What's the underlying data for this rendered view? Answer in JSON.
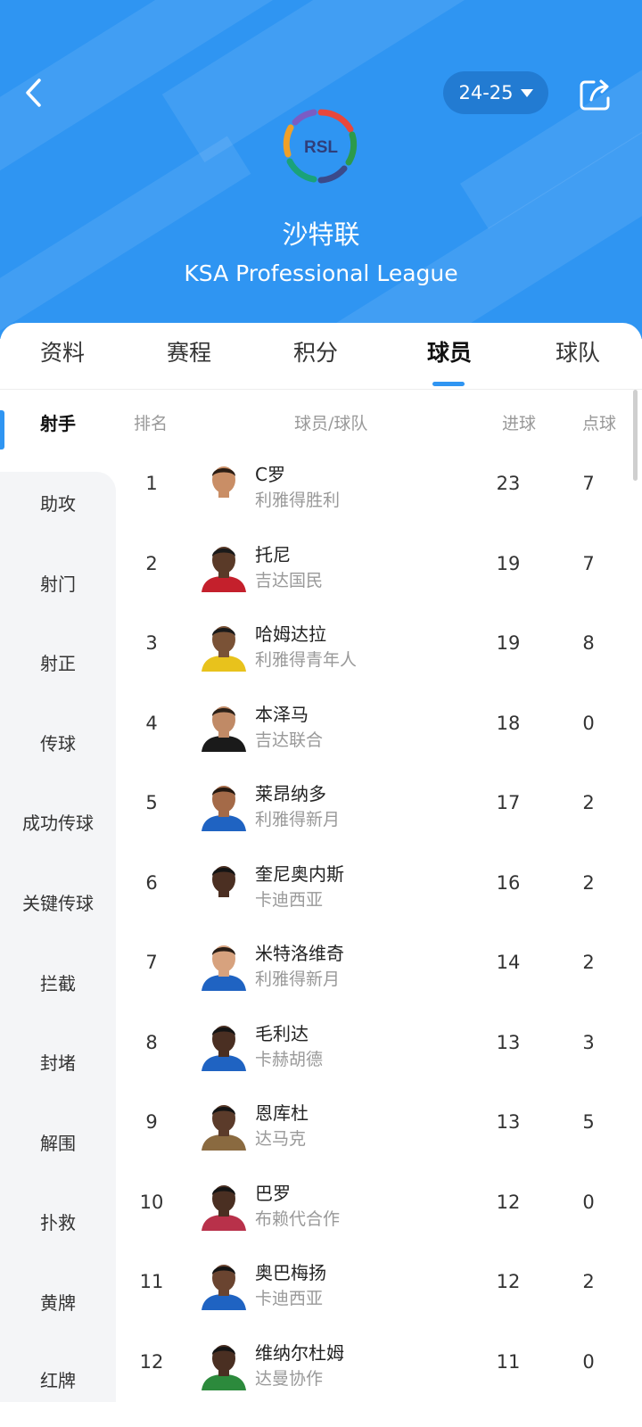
{
  "header": {
    "season": "24-25",
    "league_name": "沙特联",
    "league_name_en": "KSA Professional League",
    "logo_text": "RSL",
    "icons": {
      "back": "back-chevron-icon",
      "share": "share-icon",
      "season_dropdown": "caret-down-icon"
    },
    "colors": {
      "header_bg": "#2f95f2",
      "accent": "#2f95f2"
    }
  },
  "tabs": [
    {
      "label": "资料",
      "active": false
    },
    {
      "label": "赛程",
      "active": false
    },
    {
      "label": "积分",
      "active": false
    },
    {
      "label": "球员",
      "active": true
    },
    {
      "label": "球队",
      "active": false
    }
  ],
  "sidebar": {
    "items": [
      {
        "label": "射手",
        "active": true
      },
      {
        "label": "助攻"
      },
      {
        "label": "射门"
      },
      {
        "label": "射正"
      },
      {
        "label": "传球"
      },
      {
        "label": "成功传球"
      },
      {
        "label": "关键传球"
      },
      {
        "label": "拦截"
      },
      {
        "label": "封堵"
      },
      {
        "label": "解围"
      },
      {
        "label": "扑救"
      },
      {
        "label": "黄牌"
      },
      {
        "label": "红牌"
      }
    ]
  },
  "table": {
    "headers": {
      "rank": "排名",
      "player": "球员/球队",
      "goals": "进球",
      "penalties": "点球"
    },
    "rows": [
      {
        "rank": "1",
        "name": "C罗",
        "team": "利雅得胜利",
        "goals": "23",
        "penalties": "7"
      },
      {
        "rank": "2",
        "name": "托尼",
        "team": "吉达国民",
        "goals": "19",
        "penalties": "7"
      },
      {
        "rank": "3",
        "name": "哈姆达拉",
        "team": "利雅得青年人",
        "goals": "19",
        "penalties": "8"
      },
      {
        "rank": "4",
        "name": "本泽马",
        "team": "吉达联合",
        "goals": "18",
        "penalties": "0"
      },
      {
        "rank": "5",
        "name": "莱昂纳多",
        "team": "利雅得新月",
        "goals": "17",
        "penalties": "2"
      },
      {
        "rank": "6",
        "name": "奎尼奥内斯",
        "team": "卡迪西亚",
        "goals": "16",
        "penalties": "2"
      },
      {
        "rank": "7",
        "name": "米特洛维奇",
        "team": "利雅得新月",
        "goals": "14",
        "penalties": "2"
      },
      {
        "rank": "8",
        "name": "毛利达",
        "team": "卡赫胡德",
        "goals": "13",
        "penalties": "3"
      },
      {
        "rank": "9",
        "name": "恩库杜",
        "team": "达马克",
        "goals": "13",
        "penalties": "5"
      },
      {
        "rank": "10",
        "name": "巴罗",
        "team": "布赖代合作",
        "goals": "12",
        "penalties": "0"
      },
      {
        "rank": "11",
        "name": "奥巴梅扬",
        "team": "卡迪西亚",
        "goals": "12",
        "penalties": "2"
      },
      {
        "rank": "12",
        "name": "维纳尔杜姆",
        "team": "达曼协作",
        "goals": "11",
        "penalties": "0"
      }
    ]
  },
  "avatar_colors": [
    {
      "skin": "#c98e66",
      "hair": "#2b1d14",
      "shirt": "#ffffff"
    },
    {
      "skin": "#5a3a28",
      "hair": "#1a1a1a",
      "shirt": "#c4202c"
    },
    {
      "skin": "#7a5236",
      "hair": "#1a1a1a",
      "shirt": "#e8c21c"
    },
    {
      "skin": "#c08a66",
      "hair": "#2b2018",
      "shirt": "#1a1a1a"
    },
    {
      "skin": "#a46a48",
      "hair": "#241810",
      "shirt": "#1f63c2"
    },
    {
      "skin": "#4b2f22",
      "hair": "#141414",
      "shirt": "#ffffff"
    },
    {
      "skin": "#d7a27e",
      "hair": "#2a1e16",
      "shirt": "#1f63c2"
    },
    {
      "skin": "#4a2f22",
      "hair": "#141414",
      "shirt": "#1f63c2"
    },
    {
      "skin": "#5b3b2a",
      "hair": "#141414",
      "shirt": "#8a6a40"
    },
    {
      "skin": "#4a2f22",
      "hair": "#141414",
      "shirt": "#b8314a"
    },
    {
      "skin": "#6a4430",
      "hair": "#141414",
      "shirt": "#1f63c2"
    },
    {
      "skin": "#4a2f22",
      "hair": "#141414",
      "shirt": "#2c8a3c"
    }
  ]
}
